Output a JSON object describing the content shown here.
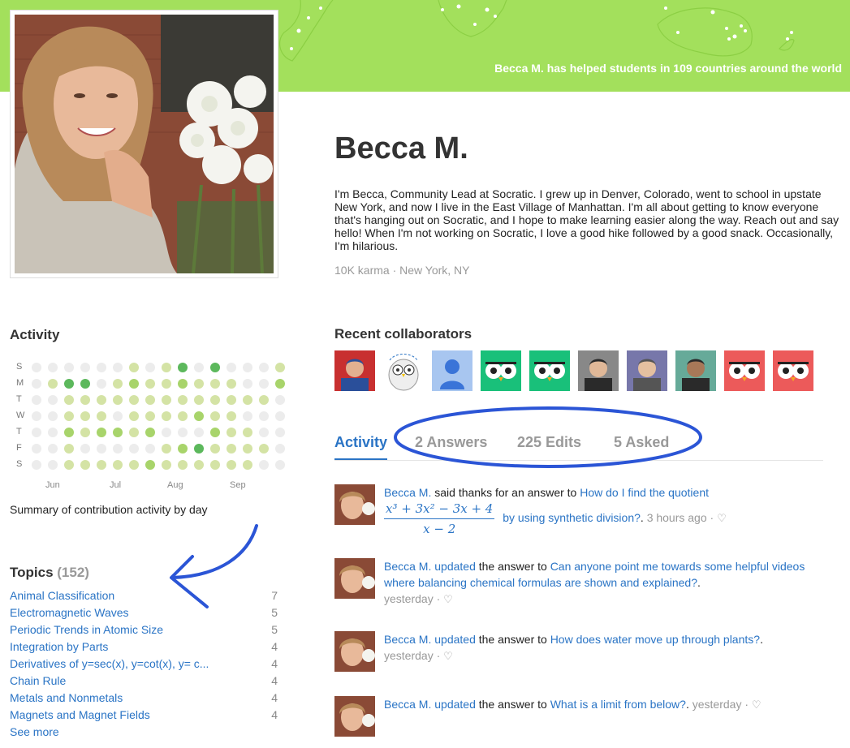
{
  "banner": {
    "caption": "Becca M. has helped students in 109 countries around the world",
    "color": "#a3e05c"
  },
  "profile": {
    "name": "Becca M.",
    "bio": "I'm Becca, Community Lead at Socratic. I grew up in Denver, Colorado, went to school in upstate New York, and now I live in the East Village of Manhattan. I'm all about getting to know everyone that's hanging out on Socratic, and I hope to make learning easier along the way. Reach out and say hello! When I'm not working on Socratic, I love a good hike followed by a good snack. Occasionally, I'm hilarious.",
    "meta": "10K karma · New York, NY"
  },
  "activity_summary": {
    "heading": "Activity",
    "day_labels": [
      "S",
      "M",
      "T",
      "W",
      "T",
      "F",
      "S"
    ],
    "month_labels": [
      "Jun",
      "Jul",
      "Aug",
      "Sep"
    ],
    "caption": "Summary of contribution activity by day",
    "level_colors": [
      "#ececec",
      "#d4e3a5",
      "#a8d46b",
      "#5cb85c"
    ],
    "grid": [
      [
        0,
        0,
        0,
        0,
        0,
        0,
        1,
        0,
        1,
        3,
        0,
        3,
        0,
        0,
        0,
        1
      ],
      [
        0,
        1,
        3,
        3,
        0,
        1,
        2,
        1,
        1,
        2,
        1,
        1,
        1,
        0,
        0,
        2
      ],
      [
        0,
        0,
        1,
        1,
        1,
        1,
        1,
        1,
        1,
        1,
        1,
        1,
        1,
        1,
        1,
        0
      ],
      [
        0,
        0,
        1,
        1,
        1,
        0,
        1,
        1,
        1,
        1,
        2,
        1,
        1,
        0,
        0,
        0
      ],
      [
        0,
        0,
        2,
        1,
        2,
        2,
        1,
        2,
        0,
        0,
        0,
        2,
        1,
        1,
        0,
        0
      ],
      [
        0,
        0,
        1,
        0,
        0,
        0,
        0,
        0,
        1,
        2,
        3,
        1,
        1,
        1,
        1,
        0
      ],
      [
        0,
        0,
        1,
        1,
        1,
        1,
        1,
        2,
        1,
        1,
        1,
        1,
        1,
        1,
        0,
        0
      ]
    ]
  },
  "topics": {
    "heading": "Topics",
    "count": "(152)",
    "items": [
      {
        "name": "Animal Classification",
        "count": "7"
      },
      {
        "name": "Electromagnetic Waves",
        "count": "5"
      },
      {
        "name": "Periodic Trends in Atomic Size",
        "count": "5"
      },
      {
        "name": "Integration by Parts",
        "count": "4"
      },
      {
        "name": "Derivatives of y=sec(x), y=cot(x), y= c...",
        "count": "4"
      },
      {
        "name": "Chain Rule",
        "count": "4"
      },
      {
        "name": "Metals and Nonmetals",
        "count": "4"
      },
      {
        "name": "Magnets and Magnet Fields",
        "count": "4"
      }
    ],
    "see_more": "See more"
  },
  "collaborators": {
    "heading": "Recent collaborators",
    "avatars": [
      "photo",
      "owl-sketch",
      "default-user",
      "owl-green",
      "owl-green",
      "photo",
      "photo",
      "photo",
      "owl-red",
      "owl-red"
    ]
  },
  "tabs": [
    {
      "label": "Activity",
      "active": true
    },
    {
      "label": "2 Answers",
      "active": false
    },
    {
      "label": "225 Edits",
      "active": false
    },
    {
      "label": "5 Asked",
      "active": false
    }
  ],
  "feed": [
    {
      "user": "Becca M.",
      "action": " said thanks for an answer to ",
      "question": "How do I find the quotient",
      "math_num": "x³ + 3x² − 3x + 4",
      "math_den": "x − 2",
      "question_tail": "by using synthetic division?",
      "time": "3 hours ago"
    },
    {
      "user": "Becca M.",
      "verb": "updated",
      "action": " the answer to ",
      "question": "Can anyone point me towards some helpful videos where balancing chemical formulas are shown and explained?",
      "time": "yesterday"
    },
    {
      "user": "Becca M.",
      "verb": "updated",
      "action": " the answer to ",
      "question": "How does water move up through plants?",
      "time": "yesterday"
    },
    {
      "user": "Becca M.",
      "verb": "updated",
      "action": " the answer to ",
      "question": "What is a limit from below?",
      "time": "yesterday"
    }
  ],
  "icons": {
    "heart": "heart-icon",
    "arrow": "hand-drawn-arrow",
    "ellipse": "hand-drawn-ellipse"
  }
}
